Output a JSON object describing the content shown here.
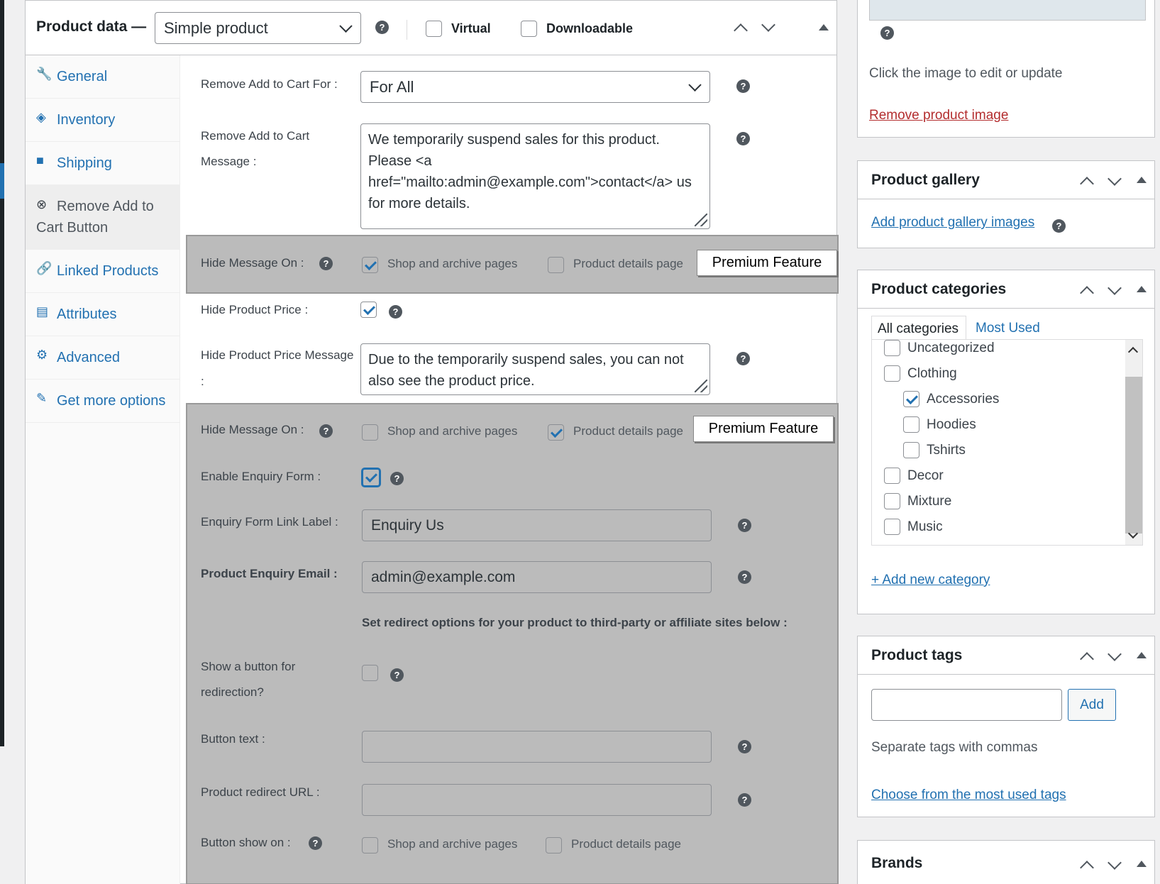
{
  "product_data": {
    "title": "Product data —",
    "type_select": "Simple product",
    "virtual_label": "Virtual",
    "downloadable_label": "Downloadable"
  },
  "tabs": [
    {
      "label_line1": "General",
      "label_line2": "",
      "icon": "wrench-icon"
    },
    {
      "label_line1": "Inventory",
      "label_line2": "",
      "icon": "tag-icon"
    },
    {
      "label_line1": "Shipping",
      "label_line2": "",
      "icon": "truck-icon"
    },
    {
      "label_line1": "Remove Add to",
      "label_line2": "Cart Button",
      "icon": "close-circle-icon"
    },
    {
      "label_line1": "Linked Products",
      "label_line2": "",
      "icon": "link-icon"
    },
    {
      "label_line1": "Attributes",
      "label_line2": "",
      "icon": "list-icon"
    },
    {
      "label_line1": "Advanced",
      "label_line2": "",
      "icon": "gear-icon"
    },
    {
      "label_line1": "Get more options",
      "label_line2": "",
      "icon": "plugin-icon"
    }
  ],
  "fields": {
    "remove_for_label": "Remove Add to Cart For :",
    "remove_for_value": "For All",
    "message_label_1": "Remove Add to Cart",
    "message_label_2": "Message :",
    "message_lines": [
      "We temporarily suspend sales for this product.",
      "Please <a",
      "href=\"mailto:admin@example.com\">contact</a> us",
      "for more details."
    ],
    "hide_msg_label": "Hide Message On :",
    "shop_archive": "Shop and archive pages",
    "product_details": "Product details page",
    "premium": "Premium Feature",
    "hide_price_label": "Hide Product Price :",
    "hide_price_msg_label_1": "Hide Product Price Message",
    "hide_price_msg_label_2": ":",
    "hide_price_msg_lines": [
      "Due to the temporarily suspend sales, you can not",
      "also see the product price."
    ],
    "enable_enquiry_label": "Enable Enquiry Form :",
    "enquiry_link_label": "Enquiry Form Link Label :",
    "enquiry_link_value": "Enquiry Us",
    "enquiry_email_label": "Product Enquiry Email :",
    "enquiry_email_value": "admin@example.com",
    "redirect_note": "Set redirect options for your product to third-party or affiliate sites below :",
    "show_button_label_1": "Show a button for",
    "show_button_label_2": "redirection?",
    "button_text_label": "Button text :",
    "redirect_url_label": "Product redirect URL :",
    "button_show_on_label": "Button show on :"
  },
  "sidebar": {
    "image_hint": "Click the image to edit or update",
    "remove_image": "Remove product image",
    "gallery_title": "Product gallery",
    "gallery_link": "Add product gallery images",
    "categories_title": "Product categories",
    "cat_tab_all": "All categories",
    "cat_tab_most": "Most Used",
    "categories": [
      {
        "name": "Uncategorized",
        "checked": false,
        "child": false
      },
      {
        "name": "Clothing",
        "checked": false,
        "child": false
      },
      {
        "name": "Accessories",
        "checked": true,
        "child": true
      },
      {
        "name": "Hoodies",
        "checked": false,
        "child": true
      },
      {
        "name": "Tshirts",
        "checked": false,
        "child": true
      },
      {
        "name": "Decor",
        "checked": false,
        "child": false
      },
      {
        "name": "Mixture",
        "checked": false,
        "child": false
      },
      {
        "name": "Music",
        "checked": false,
        "child": false
      }
    ],
    "add_category": "+ Add new category",
    "tags_title": "Product tags",
    "tags_add": "Add",
    "tags_hint": "Separate tags with commas",
    "tags_choose": "Choose from the most used tags",
    "brands_title": "Brands"
  },
  "colors": {
    "accent": "#2271b1",
    "danger": "#b32d2e",
    "premium_bg": "#bbbbbb"
  }
}
